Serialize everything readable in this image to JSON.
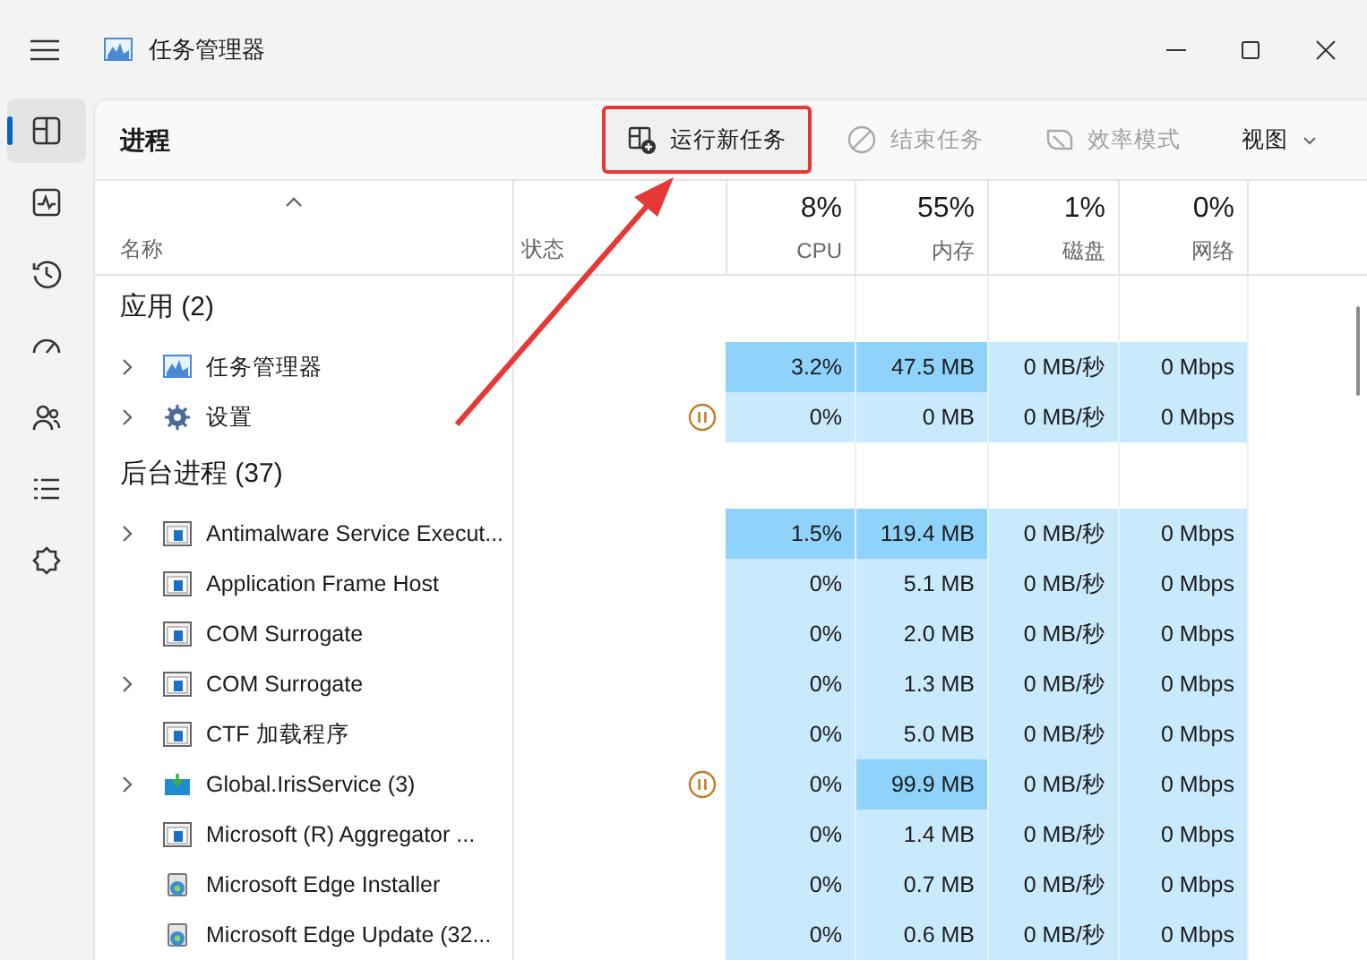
{
  "window": {
    "title": "任务管理器"
  },
  "nav": [
    {
      "kind": "processes",
      "selected": true
    },
    {
      "kind": "performance",
      "selected": false
    },
    {
      "kind": "history",
      "selected": false
    },
    {
      "kind": "startup",
      "selected": false
    },
    {
      "kind": "users",
      "selected": false
    },
    {
      "kind": "details",
      "selected": false
    },
    {
      "kind": "services",
      "selected": false
    }
  ],
  "page": {
    "title": "进程"
  },
  "toolbar": [
    {
      "kind": "run",
      "label": "运行新任务",
      "disabled": false,
      "annotated": true
    },
    {
      "kind": "end",
      "label": "结束任务",
      "disabled": true,
      "annotated": false
    },
    {
      "kind": "efficiency",
      "label": "效率模式",
      "disabled": true,
      "annotated": false
    },
    {
      "kind": "menu",
      "label": "视图",
      "disabled": false,
      "annotated": false
    }
  ],
  "columns": [
    {
      "kind": "name",
      "label": "名称",
      "sorted": true
    },
    {
      "kind": "status",
      "label": "状态",
      "sorted": false
    },
    {
      "kind": "metric",
      "total": "8%",
      "label": "CPU",
      "sorted": false
    },
    {
      "kind": "metric",
      "total": "55%",
      "label": "内存",
      "sorted": false
    },
    {
      "kind": "metric",
      "total": "1%",
      "label": "磁盘",
      "sorted": false
    },
    {
      "kind": "metric",
      "total": "0%",
      "label": "网络",
      "sorted": false
    }
  ],
  "groups": [
    {
      "label": "应用 (2)",
      "rows": [
        {
          "name": "任务管理器",
          "kind": "chart",
          "expandable": true,
          "paused": false,
          "cells": [
            {
              "text": "3.2%",
              "hot": true
            },
            {
              "text": "47.5 MB",
              "hot": true
            },
            {
              "text": "0 MB/秒",
              "hot": false
            },
            {
              "text": "0 Mbps",
              "hot": false
            }
          ]
        },
        {
          "name": "设置",
          "kind": "gear",
          "expandable": true,
          "paused": true,
          "cells": [
            {
              "text": "0%",
              "hot": false
            },
            {
              "text": "0 MB",
              "hot": false
            },
            {
              "text": "0 MB/秒",
              "hot": false
            },
            {
              "text": "0 Mbps",
              "hot": false
            }
          ]
        }
      ]
    },
    {
      "label": "后台进程 (37)",
      "rows": [
        {
          "name": "Antimalware Service Execut...",
          "kind": "window",
          "expandable": true,
          "paused": false,
          "cells": [
            {
              "text": "1.5%",
              "hot": true
            },
            {
              "text": "119.4 MB",
              "hot": true
            },
            {
              "text": "0 MB/秒",
              "hot": false
            },
            {
              "text": "0 Mbps",
              "hot": false
            }
          ]
        },
        {
          "name": "Application Frame Host",
          "kind": "window",
          "expandable": false,
          "paused": false,
          "cells": [
            {
              "text": "0%",
              "hot": false
            },
            {
              "text": "5.1 MB",
              "hot": false
            },
            {
              "text": "0 MB/秒",
              "hot": false
            },
            {
              "text": "0 Mbps",
              "hot": false
            }
          ]
        },
        {
          "name": "COM Surrogate",
          "kind": "window",
          "expandable": false,
          "paused": false,
          "cells": [
            {
              "text": "0%",
              "hot": false
            },
            {
              "text": "2.0 MB",
              "hot": false
            },
            {
              "text": "0 MB/秒",
              "hot": false
            },
            {
              "text": "0 Mbps",
              "hot": false
            }
          ]
        },
        {
          "name": "COM Surrogate",
          "kind": "window",
          "expandable": true,
          "paused": false,
          "cells": [
            {
              "text": "0%",
              "hot": false
            },
            {
              "text": "1.3 MB",
              "hot": false
            },
            {
              "text": "0 MB/秒",
              "hot": false
            },
            {
              "text": "0 Mbps",
              "hot": false
            }
          ]
        },
        {
          "name": "CTF 加载程序",
          "kind": "window",
          "expandable": false,
          "paused": false,
          "cells": [
            {
              "text": "0%",
              "hot": false
            },
            {
              "text": "5.0 MB",
              "hot": false
            },
            {
              "text": "0 MB/秒",
              "hot": false
            },
            {
              "text": "0 Mbps",
              "hot": false
            }
          ]
        },
        {
          "name": "Global.IrisService (3)",
          "kind": "package",
          "expandable": true,
          "paused": true,
          "cells": [
            {
              "text": "0%",
              "hot": false
            },
            {
              "text": "99.9 MB",
              "hot": true
            },
            {
              "text": "0 MB/秒",
              "hot": false
            },
            {
              "text": "0 Mbps",
              "hot": false
            }
          ]
        },
        {
          "name": "Microsoft (R) Aggregator ...",
          "kind": "window",
          "expandable": false,
          "paused": false,
          "cells": [
            {
              "text": "0%",
              "hot": false
            },
            {
              "text": "1.4 MB",
              "hot": false
            },
            {
              "text": "0 MB/秒",
              "hot": false
            },
            {
              "text": "0 Mbps",
              "hot": false
            }
          ]
        },
        {
          "name": "Microsoft Edge Installer",
          "kind": "installer",
          "expandable": false,
          "paused": false,
          "cells": [
            {
              "text": "0%",
              "hot": false
            },
            {
              "text": "0.7 MB",
              "hot": false
            },
            {
              "text": "0 MB/秒",
              "hot": false
            },
            {
              "text": "0 Mbps",
              "hot": false
            }
          ]
        },
        {
          "name": "Microsoft Edge Update (32...",
          "kind": "installer",
          "expandable": false,
          "paused": false,
          "cells": [
            {
              "text": "0%",
              "hot": false
            },
            {
              "text": "0.6 MB",
              "hot": false
            },
            {
              "text": "0 MB/秒",
              "hot": false
            },
            {
              "text": "0 Mbps",
              "hot": false
            }
          ]
        }
      ]
    }
  ]
}
